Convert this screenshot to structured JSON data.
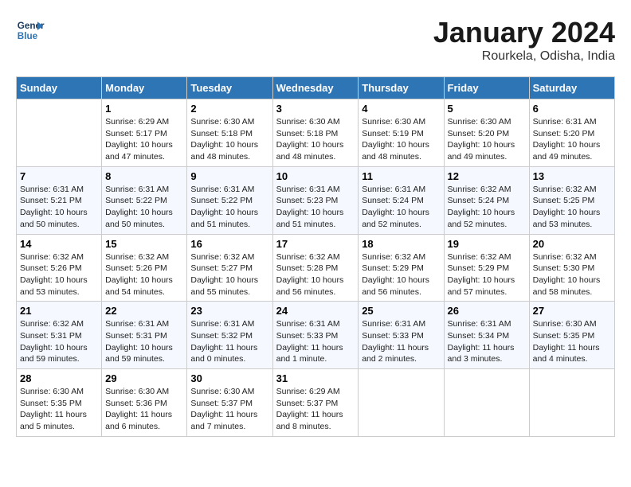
{
  "header": {
    "logo": {
      "line1": "General",
      "line2": "Blue"
    },
    "title": "January 2024",
    "subtitle": "Rourkela, Odisha, India"
  },
  "columns": [
    "Sunday",
    "Monday",
    "Tuesday",
    "Wednesday",
    "Thursday",
    "Friday",
    "Saturday"
  ],
  "weeks": [
    [
      {
        "day": "",
        "sunrise": "",
        "sunset": "",
        "daylight": ""
      },
      {
        "day": "1",
        "sunrise": "Sunrise: 6:29 AM",
        "sunset": "Sunset: 5:17 PM",
        "daylight": "Daylight: 10 hours and 47 minutes."
      },
      {
        "day": "2",
        "sunrise": "Sunrise: 6:30 AM",
        "sunset": "Sunset: 5:18 PM",
        "daylight": "Daylight: 10 hours and 48 minutes."
      },
      {
        "day": "3",
        "sunrise": "Sunrise: 6:30 AM",
        "sunset": "Sunset: 5:18 PM",
        "daylight": "Daylight: 10 hours and 48 minutes."
      },
      {
        "day": "4",
        "sunrise": "Sunrise: 6:30 AM",
        "sunset": "Sunset: 5:19 PM",
        "daylight": "Daylight: 10 hours and 48 minutes."
      },
      {
        "day": "5",
        "sunrise": "Sunrise: 6:30 AM",
        "sunset": "Sunset: 5:20 PM",
        "daylight": "Daylight: 10 hours and 49 minutes."
      },
      {
        "day": "6",
        "sunrise": "Sunrise: 6:31 AM",
        "sunset": "Sunset: 5:20 PM",
        "daylight": "Daylight: 10 hours and 49 minutes."
      }
    ],
    [
      {
        "day": "7",
        "sunrise": "Sunrise: 6:31 AM",
        "sunset": "Sunset: 5:21 PM",
        "daylight": "Daylight: 10 hours and 50 minutes."
      },
      {
        "day": "8",
        "sunrise": "Sunrise: 6:31 AM",
        "sunset": "Sunset: 5:22 PM",
        "daylight": "Daylight: 10 hours and 50 minutes."
      },
      {
        "day": "9",
        "sunrise": "Sunrise: 6:31 AM",
        "sunset": "Sunset: 5:22 PM",
        "daylight": "Daylight: 10 hours and 51 minutes."
      },
      {
        "day": "10",
        "sunrise": "Sunrise: 6:31 AM",
        "sunset": "Sunset: 5:23 PM",
        "daylight": "Daylight: 10 hours and 51 minutes."
      },
      {
        "day": "11",
        "sunrise": "Sunrise: 6:31 AM",
        "sunset": "Sunset: 5:24 PM",
        "daylight": "Daylight: 10 hours and 52 minutes."
      },
      {
        "day": "12",
        "sunrise": "Sunrise: 6:32 AM",
        "sunset": "Sunset: 5:24 PM",
        "daylight": "Daylight: 10 hours and 52 minutes."
      },
      {
        "day": "13",
        "sunrise": "Sunrise: 6:32 AM",
        "sunset": "Sunset: 5:25 PM",
        "daylight": "Daylight: 10 hours and 53 minutes."
      }
    ],
    [
      {
        "day": "14",
        "sunrise": "Sunrise: 6:32 AM",
        "sunset": "Sunset: 5:26 PM",
        "daylight": "Daylight: 10 hours and 53 minutes."
      },
      {
        "day": "15",
        "sunrise": "Sunrise: 6:32 AM",
        "sunset": "Sunset: 5:26 PM",
        "daylight": "Daylight: 10 hours and 54 minutes."
      },
      {
        "day": "16",
        "sunrise": "Sunrise: 6:32 AM",
        "sunset": "Sunset: 5:27 PM",
        "daylight": "Daylight: 10 hours and 55 minutes."
      },
      {
        "day": "17",
        "sunrise": "Sunrise: 6:32 AM",
        "sunset": "Sunset: 5:28 PM",
        "daylight": "Daylight: 10 hours and 56 minutes."
      },
      {
        "day": "18",
        "sunrise": "Sunrise: 6:32 AM",
        "sunset": "Sunset: 5:29 PM",
        "daylight": "Daylight: 10 hours and 56 minutes."
      },
      {
        "day": "19",
        "sunrise": "Sunrise: 6:32 AM",
        "sunset": "Sunset: 5:29 PM",
        "daylight": "Daylight: 10 hours and 57 minutes."
      },
      {
        "day": "20",
        "sunrise": "Sunrise: 6:32 AM",
        "sunset": "Sunset: 5:30 PM",
        "daylight": "Daylight: 10 hours and 58 minutes."
      }
    ],
    [
      {
        "day": "21",
        "sunrise": "Sunrise: 6:32 AM",
        "sunset": "Sunset: 5:31 PM",
        "daylight": "Daylight: 10 hours and 59 minutes."
      },
      {
        "day": "22",
        "sunrise": "Sunrise: 6:31 AM",
        "sunset": "Sunset: 5:31 PM",
        "daylight": "Daylight: 10 hours and 59 minutes."
      },
      {
        "day": "23",
        "sunrise": "Sunrise: 6:31 AM",
        "sunset": "Sunset: 5:32 PM",
        "daylight": "Daylight: 11 hours and 0 minutes."
      },
      {
        "day": "24",
        "sunrise": "Sunrise: 6:31 AM",
        "sunset": "Sunset: 5:33 PM",
        "daylight": "Daylight: 11 hours and 1 minute."
      },
      {
        "day": "25",
        "sunrise": "Sunrise: 6:31 AM",
        "sunset": "Sunset: 5:33 PM",
        "daylight": "Daylight: 11 hours and 2 minutes."
      },
      {
        "day": "26",
        "sunrise": "Sunrise: 6:31 AM",
        "sunset": "Sunset: 5:34 PM",
        "daylight": "Daylight: 11 hours and 3 minutes."
      },
      {
        "day": "27",
        "sunrise": "Sunrise: 6:30 AM",
        "sunset": "Sunset: 5:35 PM",
        "daylight": "Daylight: 11 hours and 4 minutes."
      }
    ],
    [
      {
        "day": "28",
        "sunrise": "Sunrise: 6:30 AM",
        "sunset": "Sunset: 5:35 PM",
        "daylight": "Daylight: 11 hours and 5 minutes."
      },
      {
        "day": "29",
        "sunrise": "Sunrise: 6:30 AM",
        "sunset": "Sunset: 5:36 PM",
        "daylight": "Daylight: 11 hours and 6 minutes."
      },
      {
        "day": "30",
        "sunrise": "Sunrise: 6:30 AM",
        "sunset": "Sunset: 5:37 PM",
        "daylight": "Daylight: 11 hours and 7 minutes."
      },
      {
        "day": "31",
        "sunrise": "Sunrise: 6:29 AM",
        "sunset": "Sunset: 5:37 PM",
        "daylight": "Daylight: 11 hours and 8 minutes."
      },
      {
        "day": "",
        "sunrise": "",
        "sunset": "",
        "daylight": ""
      },
      {
        "day": "",
        "sunrise": "",
        "sunset": "",
        "daylight": ""
      },
      {
        "day": "",
        "sunrise": "",
        "sunset": "",
        "daylight": ""
      }
    ]
  ]
}
